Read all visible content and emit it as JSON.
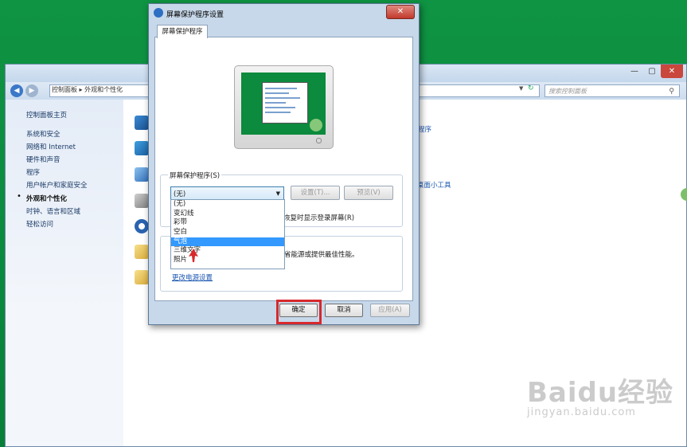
{
  "control_panel": {
    "address_path": "控制面板 ▸ 外观和个性化",
    "search_placeholder": "搜索控制面板",
    "sidebar": {
      "home": "控制面板主页",
      "items": [
        {
          "label": "系统和安全",
          "active": false
        },
        {
          "label": "网络和 Internet",
          "active": false
        },
        {
          "label": "硬件和声音",
          "active": false
        },
        {
          "label": "程序",
          "active": false
        },
        {
          "label": "用户帐户和家庭安全",
          "active": false
        },
        {
          "label": "外观和个性化",
          "active": true
        },
        {
          "label": "时钟、语言和区域",
          "active": false
        },
        {
          "label": "轻松访问",
          "active": false
        }
      ]
    },
    "main_links": [
      "程序",
      "桌面小工具"
    ]
  },
  "dialog": {
    "title": "屏幕保护程序设置",
    "tab_label": "屏幕保护程序",
    "screensaver_group_label": "屏幕保护程序(S)",
    "selected_screensaver": "(无)",
    "settings_button": "设置(T)...",
    "preview_button": "预览(V)",
    "wait_text": "恢复时显示登录屏幕(R)",
    "power_description": "省能源或提供最佳性能。",
    "power_link": "更改电源设置",
    "dropdown_options": [
      "(无)",
      "变幻线",
      "彩带",
      "空白",
      "气泡",
      "三维文字",
      "照片"
    ],
    "dropdown_selected_index": 4,
    "ok_button": "确定",
    "cancel_button": "取消",
    "apply_button": "应用(A)"
  },
  "watermark": {
    "main": "Baidu经验",
    "sub": "jingyan.baidu.com"
  },
  "colors": {
    "desktop": "#0a8a3e",
    "highlight_box": "#d8282c",
    "selection": "#3399ff",
    "link": "#1a56b0"
  }
}
